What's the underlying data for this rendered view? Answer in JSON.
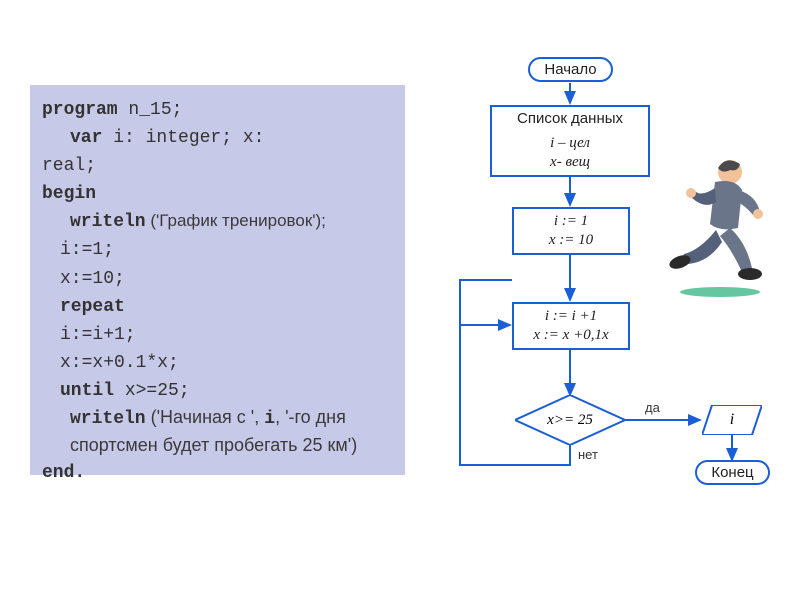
{
  "code": {
    "l1a": "program",
    "l1b": " n_15;",
    "l2a": "var",
    "l2b": " i: integer; x: ",
    "l2c": "real;",
    "l3": "begin",
    "l4a": "writeln",
    "l4b": " ('График тренировок');",
    "l5": "i:=1;",
    "l6": "x:=10;",
    "l7": "repeat",
    "l8": "i:=i+1;",
    "l9": "x:=x+0.1*x;",
    "l10a": "until",
    "l10b": " x>=25;",
    "l11a": "writeln",
    "l11b": " ('Начиная с ', ",
    "l11c": "i",
    "l11d": ", '-го    дня спортсмен будет пробегать 25 км')",
    "l12": "end."
  },
  "flow": {
    "start": "Начало",
    "data_header": "Список данных",
    "data_body_1": "i – цел",
    "data_body_2": "x- вещ",
    "init_1": "i := 1",
    "init_2": "x := 10",
    "step_1": "i := i +1",
    "step_2": "x := x +0,1x",
    "cond": "x>= 25",
    "yes": "да",
    "no": "нет",
    "output": "i",
    "end": "Конец"
  }
}
